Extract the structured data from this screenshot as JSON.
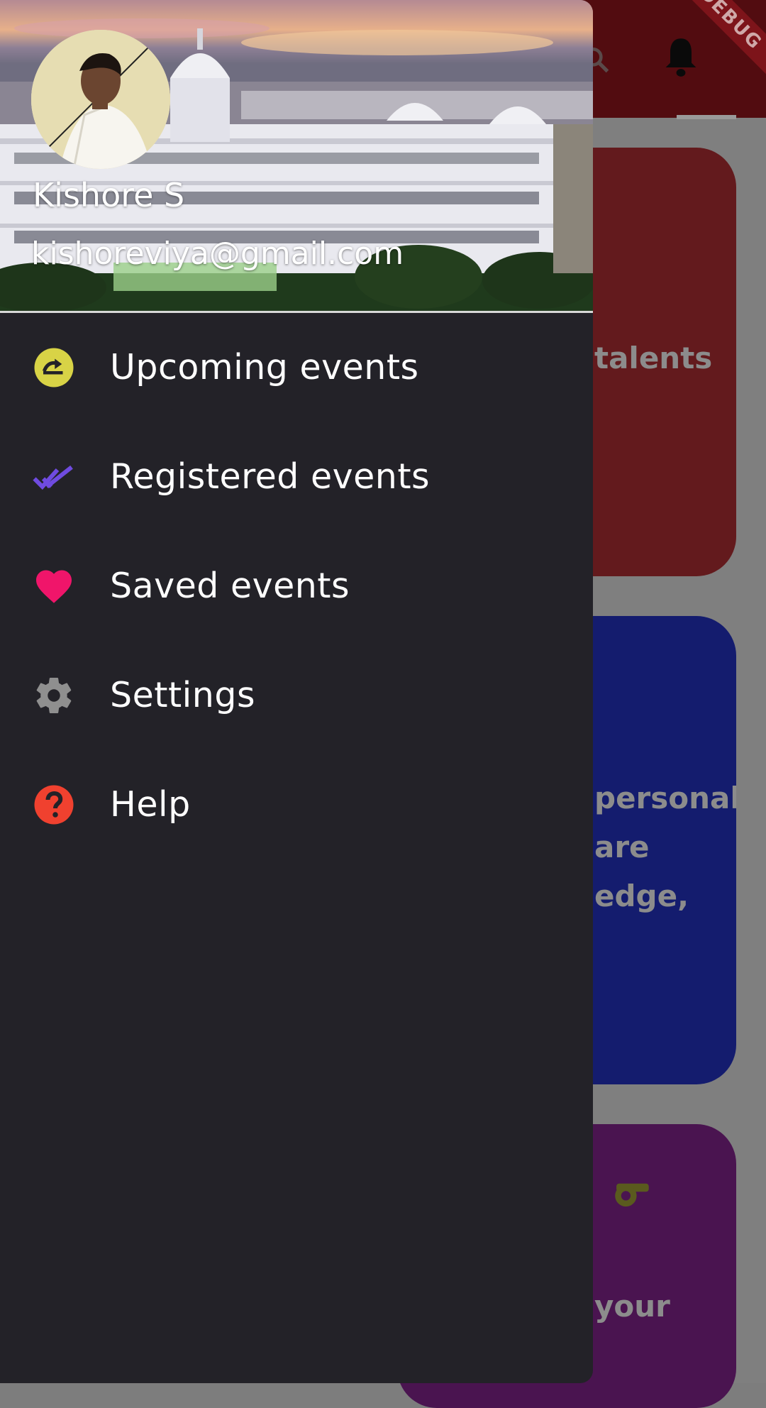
{
  "background": {
    "debug_banner": "DEBUG",
    "cards": [
      {
        "text": "talents",
        "color": "#631a1d"
      },
      {
        "text": "personal\nare\nedge,",
        "color": "#141c6e"
      },
      {
        "text": "your",
        "color": "#4a1450"
      }
    ],
    "icons": [
      "search-icon",
      "bell-icon",
      "whistle-icon"
    ]
  },
  "drawer": {
    "user": {
      "name": "Kishore S",
      "email": "kishoreviya@gmail.com"
    },
    "menu": [
      {
        "label": "Upcoming events",
        "icon": "upcoming-icon",
        "icon_color": "#d8d346"
      },
      {
        "label": "Registered events",
        "icon": "double-check-icon",
        "icon_color": "#6f4be0"
      },
      {
        "label": "Saved events",
        "icon": "heart-icon",
        "icon_color": "#f0156a"
      },
      {
        "label": "Settings",
        "icon": "gear-icon",
        "icon_color": "#8f8f8f"
      },
      {
        "label": "Help",
        "icon": "help-icon",
        "icon_color": "#f0412f"
      }
    ]
  },
  "colors": {
    "drawer_bg": "#232228",
    "appbar": "#520c10",
    "scrim": "#7f7f7f"
  }
}
